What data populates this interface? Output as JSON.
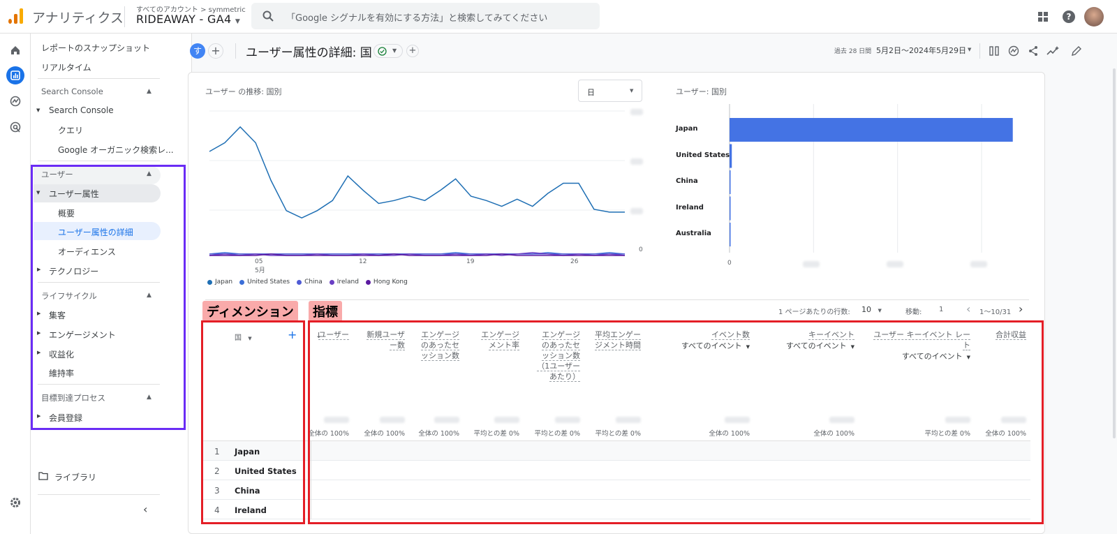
{
  "topbar": {
    "app_name": "アナリティクス",
    "crumb": "すべてのアカウント > symmetric",
    "property": "RIDEAWAY - GA4",
    "search_placeholder": "「Google シグナルを有効にする方法」と検索してみてください"
  },
  "sidenav": {
    "top_items": [
      "レポートのスナップショット",
      "リアルタイム"
    ],
    "search_console_section": "Search Console",
    "search_console_group": "Search Console",
    "search_console_items": [
      "クエリ",
      "Google オーガニック検索レ..."
    ],
    "user_section": "ユーザー",
    "user_group": "ユーザー属性",
    "user_items": [
      "概要",
      "ユーザー属性の詳細",
      "オーディエンス"
    ],
    "tech_group": "テクノロジー",
    "lifecycle_section": "ライフサイクル",
    "lifecycle_items": [
      "集客",
      "エンゲージメント",
      "収益化",
      "維持率"
    ],
    "goal_section": "目標到達プロセス",
    "goal_items": [
      "会員登録"
    ],
    "library": "ライブラリ"
  },
  "header": {
    "avatar_letter": "す",
    "title": "ユーザー属性の詳細: 国",
    "date_prefix": "過去 28 日間",
    "date_range": "5月2日～2024年5月29日"
  },
  "line_chart": {
    "title": "ユーザー の推移: 国別",
    "granularity": "日",
    "x_ticks": [
      "05",
      "12",
      "19",
      "26"
    ],
    "x_month": "5月",
    "y_zero": "0",
    "legend": [
      {
        "name": "Japan",
        "color": "#1f6fb4"
      },
      {
        "name": "United States",
        "color": "#3b6fd8"
      },
      {
        "name": "China",
        "color": "#4f5bd5"
      },
      {
        "name": "Ireland",
        "color": "#6a3fc4"
      },
      {
        "name": "Hong Kong",
        "color": "#5b1aa0"
      }
    ]
  },
  "bar_chart": {
    "title": "ユーザー: 国別",
    "x_zero": "0"
  },
  "chart_data": [
    {
      "type": "line",
      "title": "ユーザー の推移: 国別",
      "x": [
        "5/2",
        "5/3",
        "5/4",
        "5/5",
        "5/6",
        "5/7",
        "5/8",
        "5/9",
        "5/10",
        "5/11",
        "5/12",
        "5/13",
        "5/14",
        "5/15",
        "5/16",
        "5/17",
        "5/18",
        "5/19",
        "5/20",
        "5/21",
        "5/22",
        "5/23",
        "5/24",
        "5/25",
        "5/26",
        "5/27",
        "5/28",
        "5/29"
      ],
      "series": [
        {
          "name": "Japan",
          "values": [
            0.72,
            0.78,
            0.89,
            0.78,
            0.52,
            0.31,
            0.26,
            0.31,
            0.38,
            0.55,
            0.45,
            0.36,
            0.38,
            0.41,
            0.38,
            0.45,
            0.53,
            0.41,
            0.38,
            0.34,
            0.39,
            0.34,
            0.43,
            0.5,
            0.5,
            0.32,
            0.3,
            0.3
          ]
        },
        {
          "name": "United States",
          "values": [
            0.01,
            0.02,
            0.01,
            0.01,
            0.01,
            0.01,
            0.01,
            0.01,
            0.01,
            0.01,
            0.01,
            0.01,
            0.01,
            0.01,
            0.01,
            0.01,
            0.02,
            0.01,
            0.01,
            0.01,
            0.01,
            0.01,
            0.02,
            0.01,
            0.01,
            0.01,
            0.02,
            0.01
          ]
        },
        {
          "name": "China",
          "values": [
            0.01,
            0.01,
            0.01,
            0.01,
            0.01,
            0.01,
            0.01,
            0.01,
            0.01,
            0.01,
            0.01,
            0.01,
            0.01,
            0.01,
            0.01,
            0.01,
            0.01,
            0.01,
            0.01,
            0.01,
            0.01,
            0.01,
            0.01,
            0.01,
            0.01,
            0.01,
            0.01,
            0.01
          ]
        },
        {
          "name": "Ireland",
          "values": [
            0.0,
            0.01,
            0.0,
            0.01,
            0.0,
            0.0,
            0.0,
            0.01,
            0.0,
            0.0,
            0.01,
            0.0,
            0.0,
            0.01,
            0.0,
            0.0,
            0.01,
            0.0,
            0.01,
            0.0,
            0.01,
            0.02,
            0.01,
            0.0,
            0.01,
            0.0,
            0.01,
            0.0
          ]
        },
        {
          "name": "Hong Kong",
          "values": [
            0.0,
            0.0,
            0.0,
            0.0,
            0.01,
            0.0,
            0.0,
            0.0,
            0.0,
            0.0,
            0.0,
            0.0,
            0.01,
            0.0,
            0.0,
            0.0,
            0.0,
            0.0,
            0.0,
            0.01,
            0.0,
            0.0,
            0.0,
            0.0,
            0.0,
            0.0,
            0.0,
            0.0
          ]
        }
      ],
      "ylim": [
        0,
        1
      ],
      "grid": true,
      "legend_position": "bottom"
    },
    {
      "type": "bar",
      "orientation": "horizontal",
      "title": "ユーザー: 国別",
      "categories": [
        "Japan",
        "United States",
        "China",
        "Ireland",
        "Australia"
      ],
      "values": [
        100,
        0.8,
        0.3,
        0.2,
        0.2
      ],
      "xlim": [
        0,
        100
      ],
      "grid": true
    }
  ],
  "table_controls": {
    "rows_label": "1 ページあたりの行数:",
    "rows_value": "10",
    "goto_label": "移動:",
    "goto_value": "1",
    "range": "1～10/31"
  },
  "annotations": {
    "dimension": "ディメンション",
    "metric": "指標"
  },
  "table": {
    "dimension_header": "国",
    "columns": [
      {
        "label": "ユーザー",
        "sub": "",
        "total": "全体の 100%"
      },
      {
        "label": "新規ユーザー数",
        "sub": "",
        "total": "全体の 100%"
      },
      {
        "label": "エンゲージのあったセッション数",
        "sub": "",
        "total": "全体の 100%"
      },
      {
        "label": "エンゲージメント率",
        "sub": "",
        "total": "平均との差 0%"
      },
      {
        "label": "エンゲージのあったセッション数（1ユーザーあたり）",
        "sub": "",
        "total": "平均との差 0%"
      },
      {
        "label": "平均エンゲージメント時間",
        "sub": "",
        "total": "平均との差 0%"
      },
      {
        "label": "イベント数",
        "sub": "すべてのイベント",
        "total": "全体の 100%"
      },
      {
        "label": "キーイベント",
        "sub": "すべてのイベント",
        "total": "全体の 100%"
      },
      {
        "label": "ユーザー キーイベント レート",
        "sub": "すべてのイベント",
        "total": "平均との差 0%"
      },
      {
        "label": "合計収益",
        "sub": "",
        "total": "全体の 100%"
      }
    ],
    "rows": [
      {
        "n": "1",
        "country": "Japan"
      },
      {
        "n": "2",
        "country": "United States"
      },
      {
        "n": "3",
        "country": "China"
      },
      {
        "n": "4",
        "country": "Ireland"
      }
    ]
  }
}
